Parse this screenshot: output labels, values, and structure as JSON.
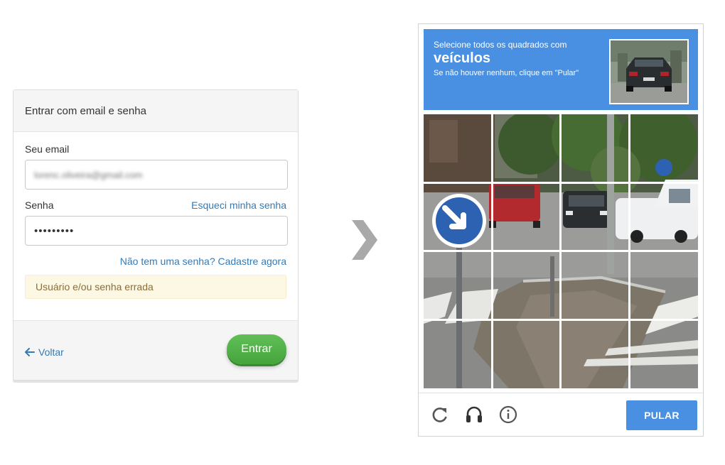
{
  "login": {
    "title": "Entrar com email e senha",
    "email_label": "Seu email",
    "email_value": "lorenc.oliveira@gmail.com",
    "password_label": "Senha",
    "forgot_link": "Esqueci minha senha",
    "password_value": "•••••••••",
    "signup_link": "Não tem uma senha? Cadastre agora",
    "error_message": "Usuário e/ou senha errada",
    "back_label": "Voltar",
    "submit_label": "Entrar"
  },
  "captcha": {
    "instruction_line1": "Selecione todos os quadrados com",
    "target": "veículos",
    "instruction_line3": "Se não houver nenhum, clique em \"Pular\"",
    "skip_label": "PULAR",
    "accent": "#4a90e2"
  },
  "icons": [
    "arrow-left-icon",
    "chevron-right-icon",
    "reload-icon",
    "headphones-icon",
    "info-icon"
  ],
  "colors": {
    "link": "#337ab7",
    "enter_button": "#4cae44",
    "alert_bg": "#fcf8e3",
    "alert_text": "#8a6d3b"
  }
}
